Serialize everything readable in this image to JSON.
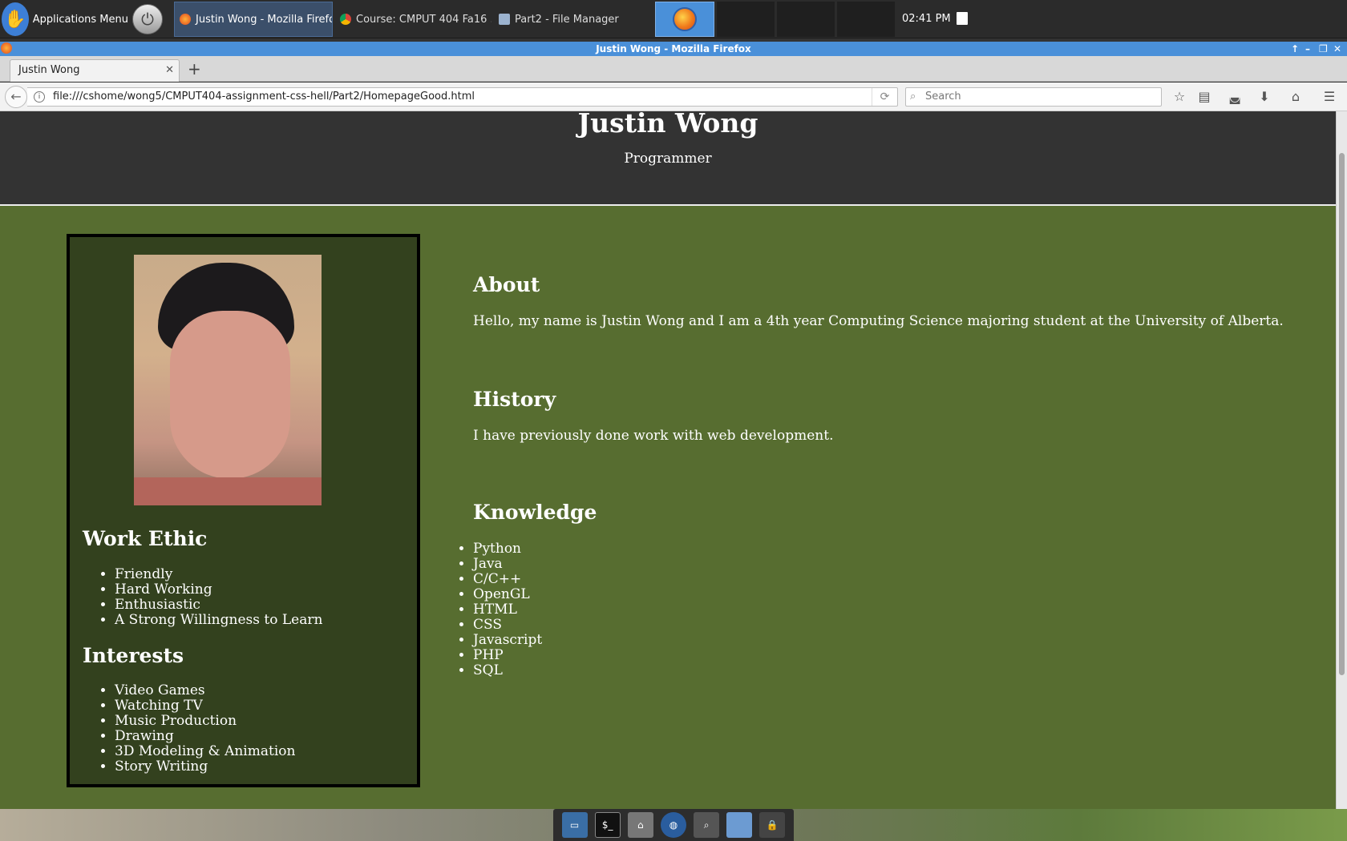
{
  "panel": {
    "applications_menu": "Applications Menu",
    "tasks": [
      {
        "label": "Justin Wong - Mozilla Firefox"
      },
      {
        "label": "Course: CMPUT 404 Fa16 ..."
      },
      {
        "label": "Part2 - File Manager"
      }
    ],
    "clock": "02:41 PM"
  },
  "window": {
    "title": "Justin Wong - Mozilla Firefox",
    "tab_title": "Justin Wong",
    "url": "file:///cshome/wong5/CMPUT404-assignment-css-hell/Part2/HomepageGood.html",
    "search_placeholder": "Search"
  },
  "page": {
    "name": "Justin Wong",
    "subtitle": "Programmer",
    "sidebar": {
      "work_ethic_title": "Work Ethic",
      "work_ethic": [
        "Friendly",
        "Hard Working",
        "Enthusiastic",
        "A Strong Willingness to Learn"
      ],
      "interests_title": "Interests",
      "interests": [
        "Video Games",
        "Watching TV",
        "Music Production",
        "Drawing",
        "3D Modeling & Animation",
        "Story Writing"
      ]
    },
    "about": {
      "title": "About",
      "text": "Hello, my name is Justin Wong and I am a 4th year Computing Science majoring student at the University of Alberta."
    },
    "history": {
      "title": "History",
      "text": "I have previously done work with web development."
    },
    "knowledge": {
      "title": "Knowledge",
      "items": [
        "Python",
        "Java",
        "C/C++",
        "OpenGL",
        "HTML",
        "CSS",
        "Javascript",
        "PHP",
        "SQL"
      ]
    }
  }
}
